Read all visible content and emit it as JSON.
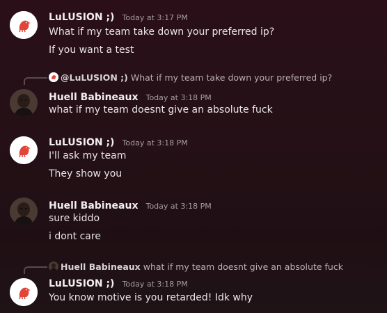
{
  "messages": [
    {
      "author": "LuLUSION ;)",
      "time": "Today at 3:17 PM",
      "lines": [
        "What if my team take down your preferred ip?",
        "If you want a test"
      ]
    },
    {
      "reply_to": {
        "author": "@LuLUSION ;)",
        "text": "What if my team take down your preferred ip?"
      },
      "author": "Huell Babineaux",
      "time": "Today at 3:18 PM",
      "lines": [
        "what if my team doesnt give an absolute fuck"
      ]
    },
    {
      "author": "LuLUSION ;)",
      "time": "Today at 3:18 PM",
      "lines": [
        "I'll ask my team",
        "They show you"
      ]
    },
    {
      "author": "Huell Babineaux",
      "time": "Today at 3:18 PM",
      "lines": [
        "sure kiddo",
        "i dont care"
      ]
    },
    {
      "reply_to": {
        "author": "Huell Babineaux",
        "text": "what if my team doesnt give an absolute fuck"
      },
      "author": "LuLUSION ;)",
      "time": "Today at 3:18 PM",
      "lines": [
        "You know motive is you retarded! Idk why"
      ]
    }
  ],
  "icons": {
    "lulusion_avatar": "red-bird-avatar-icon",
    "huell_avatar": "person-avatar-icon"
  },
  "colors": {
    "background_top": "#2a0f19",
    "background_bottom": "#1f1316",
    "bird_red": "#e0453a"
  }
}
